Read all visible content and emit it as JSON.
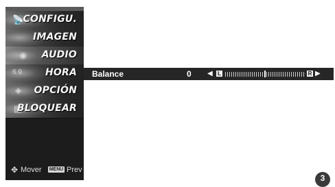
{
  "menu": {
    "items": [
      {
        "label": "CONFIGU.",
        "icon": "satellite-dish-icon"
      },
      {
        "label": "IMAGEN",
        "icon": "tv-picture-icon"
      },
      {
        "label": "AUDIO",
        "icon": "speaker-icon"
      },
      {
        "label": "HORA",
        "icon": "clock-icon"
      },
      {
        "label": "OPCIÓN",
        "icon": "option-icon"
      },
      {
        "label": "BLOQUEAR",
        "icon": "lock-icon"
      }
    ],
    "selected_index": 2
  },
  "legend": {
    "move_label": "Mover",
    "menu_key_label": "MENU",
    "prev_label": "Prev"
  },
  "balance": {
    "label": "Balance",
    "value": "0",
    "left_marker": "L",
    "right_marker": "R",
    "level": 0.5
  },
  "page_number": "3"
}
